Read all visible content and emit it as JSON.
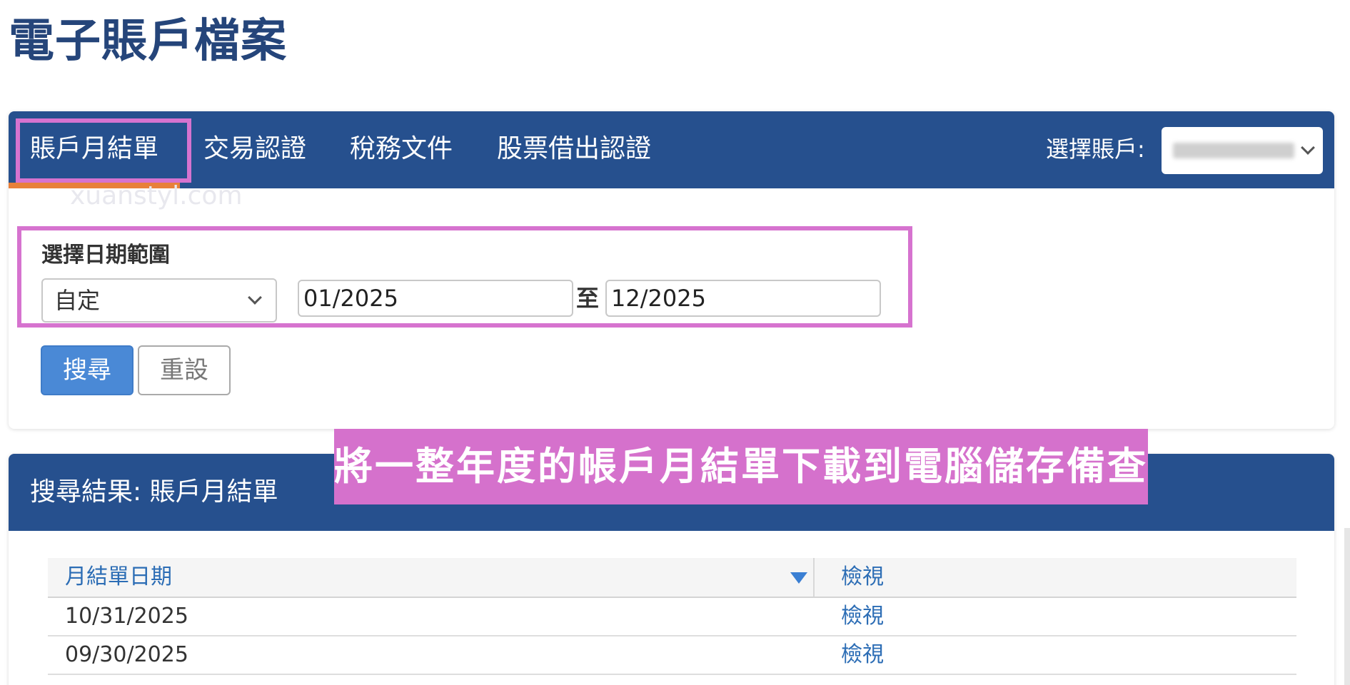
{
  "page": {
    "title": "電子賬戶檔案"
  },
  "nav": {
    "tabs": [
      {
        "label": "賬戶月結單",
        "active": true
      },
      {
        "label": "交易認證"
      },
      {
        "label": "稅務文件"
      },
      {
        "label": "股票借出認證"
      }
    ],
    "account_label": "選擇賬戶:",
    "watermark": "xuanstyl.com"
  },
  "search": {
    "range_label": "選擇日期範圍",
    "preset_value": "自定",
    "from_value": "01/2025",
    "to_separator": "至",
    "to_value": "12/2025",
    "search_button": "搜尋",
    "reset_button": "重設"
  },
  "results": {
    "title": "搜尋結果: 賬戶月結單",
    "columns": [
      "月結單日期",
      "檢視"
    ],
    "rows": [
      {
        "date": "10/31/2025",
        "view": "檢視"
      },
      {
        "date": "09/30/2025",
        "view": "檢視"
      }
    ]
  },
  "annotation": {
    "caption": "將一整年度的帳戶月結單下載到電腦儲存備查"
  },
  "colors": {
    "brand_navy": "#26508e",
    "title_navy": "#25457a",
    "accent_orange": "#e8803a",
    "highlight_pink": "#d673cf",
    "button_blue": "#4a89d6",
    "link_blue": "#2c6db5"
  }
}
